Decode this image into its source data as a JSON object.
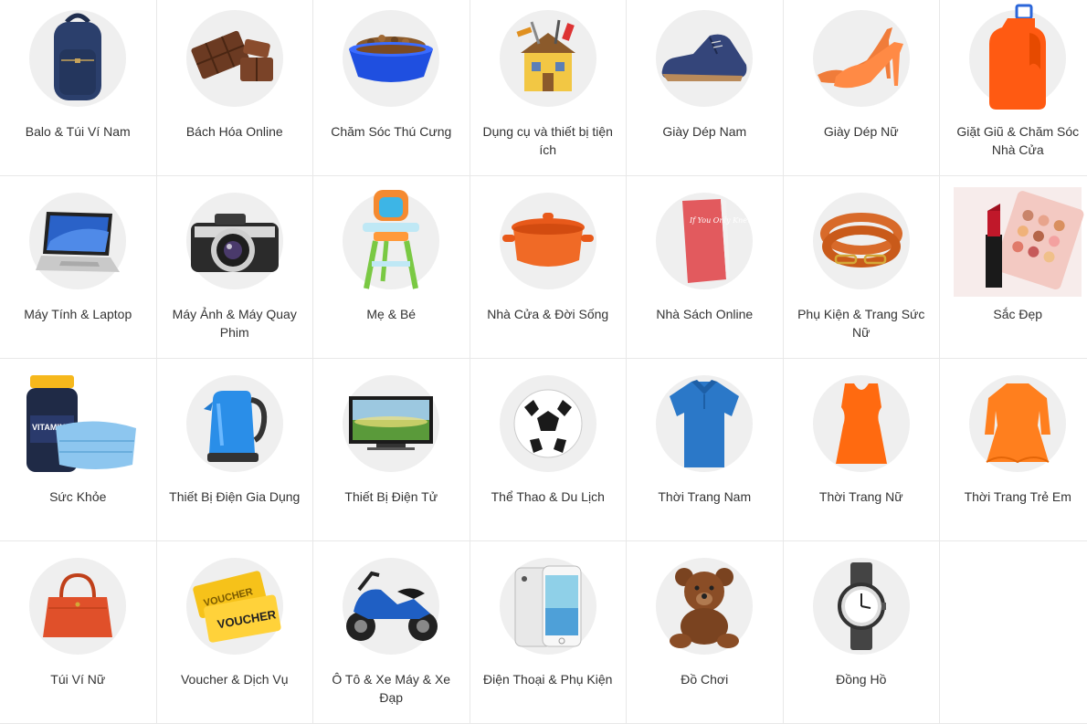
{
  "categories": [
    {
      "label": "Balo & Túi Ví Nam",
      "icon": "backpack-icon"
    },
    {
      "label": "Bách Hóa Online",
      "icon": "chocolate-icon"
    },
    {
      "label": "Chăm Sóc Thú Cưng",
      "icon": "pet-bowl-icon"
    },
    {
      "label": "Dụng cụ và thiết bị tiện ích",
      "icon": "toolbox-house-icon"
    },
    {
      "label": "Giày Dép Nam",
      "icon": "men-shoe-icon"
    },
    {
      "label": "Giày Dép Nữ",
      "icon": "high-heel-icon"
    },
    {
      "label": "Giặt Giũ & Chăm Sóc Nhà Cửa",
      "icon": "detergent-bottle-icon"
    },
    {
      "label": "Máy Tính & Laptop",
      "icon": "laptop-icon"
    },
    {
      "label": "Máy Ảnh & Máy Quay Phim",
      "icon": "camera-icon"
    },
    {
      "label": "Mẹ & Bé",
      "icon": "high-chair-icon"
    },
    {
      "label": "Nhà Cửa & Đời Sống",
      "icon": "cooking-pot-icon"
    },
    {
      "label": "Nhà Sách Online",
      "icon": "book-icon"
    },
    {
      "label": "Phụ Kiện & Trang Sức Nữ",
      "icon": "bracelet-icon"
    },
    {
      "label": "Sắc Đẹp",
      "icon": "makeup-icon"
    },
    {
      "label": "Sức Khỏe",
      "icon": "vitamin-mask-icon"
    },
    {
      "label": "Thiết Bị Điện Gia Dụng",
      "icon": "kettle-icon"
    },
    {
      "label": "Thiết Bị Điện Tử",
      "icon": "television-icon"
    },
    {
      "label": "Thể Thao & Du Lịch",
      "icon": "soccer-ball-icon"
    },
    {
      "label": "Thời Trang Nam",
      "icon": "polo-shirt-icon"
    },
    {
      "label": "Thời Trang Nữ",
      "icon": "women-top-icon"
    },
    {
      "label": "Thời Trang Trẻ Em",
      "icon": "kids-dress-icon"
    },
    {
      "label": "Túi Ví Nữ",
      "icon": "handbag-icon"
    },
    {
      "label": "Voucher & Dịch Vụ",
      "icon": "voucher-ticket-icon"
    },
    {
      "label": "Ô Tô & Xe Máy & Xe Đạp",
      "icon": "scooter-icon"
    },
    {
      "label": "Điện Thoại & Phụ Kiện",
      "icon": "smartphone-icon"
    },
    {
      "label": "Đồ Chơi",
      "icon": "teddy-bear-icon"
    },
    {
      "label": "Đồng Hồ",
      "icon": "wristwatch-icon"
    }
  ],
  "voucher_text": "VOUCHER",
  "voucher_text_small": "VOUCHER",
  "book_cover_text": "If You Only Knew",
  "vitamin_text": "VITAMIN D",
  "colors": {
    "border": "#e8e8e8",
    "thumb_bg": "#efefef",
    "label": "#333333"
  }
}
